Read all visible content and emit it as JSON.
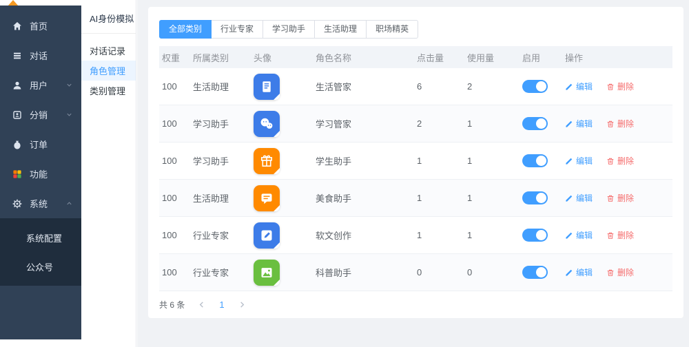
{
  "brand": {
    "arrow_color": "#f59a23"
  },
  "sidebar": {
    "bg": "#304156",
    "submenu_bg": "#1f2d3d",
    "items": [
      {
        "label": "首页",
        "icon": "home-icon"
      },
      {
        "label": "对话",
        "icon": "chat-list-icon"
      },
      {
        "label": "用户",
        "icon": "user-icon",
        "arrow": "down"
      },
      {
        "label": "分销",
        "icon": "distribution-icon",
        "arrow": "down"
      },
      {
        "label": "订单",
        "icon": "order-icon"
      },
      {
        "label": "功能",
        "icon": "features-grid-icon"
      },
      {
        "label": "系统",
        "icon": "gear-icon",
        "arrow": "up",
        "expanded": true
      }
    ],
    "system_submenu": [
      {
        "label": "系统配置"
      },
      {
        "label": "公众号"
      }
    ]
  },
  "panel": {
    "title": "AI身份模拟",
    "items": [
      {
        "label": "对话记录",
        "active": false
      },
      {
        "label": "角色管理",
        "active": true
      },
      {
        "label": "类别管理",
        "active": false
      }
    ],
    "active_color": "#409eff",
    "active_bg": "#ecf5ff"
  },
  "tabs": [
    {
      "label": "全部类别",
      "active": true
    },
    {
      "label": "行业专家",
      "active": false
    },
    {
      "label": "学习助手",
      "active": false
    },
    {
      "label": "生活助理",
      "active": false
    },
    {
      "label": "职场精英",
      "active": false
    }
  ],
  "table": {
    "columns": {
      "weight": "权重",
      "category": "所属类别",
      "avatar": "头像",
      "name": "角色名称",
      "clicks": "点击量",
      "usage": "使用量",
      "enabled": "启用",
      "actions": "操作"
    },
    "edit_label": "编辑",
    "delete_label": "删除",
    "rows": [
      {
        "weight": "100",
        "category": "生活助理",
        "avatar_icon": "document-icon",
        "avatar_style": "background:#3d7ce8;color:#3d7ce8",
        "name": "生活管家",
        "clicks": "6",
        "usage": "2",
        "enabled": true
      },
      {
        "weight": "100",
        "category": "学习助手",
        "avatar_icon": "wechat-icon",
        "avatar_style": "background:#3d7ce8;color:#3d7ce8",
        "name": "学习管家",
        "clicks": "2",
        "usage": "1",
        "enabled": true
      },
      {
        "weight": "100",
        "category": "学习助手",
        "avatar_icon": "gift-icon",
        "avatar_style": "background:#ff8a00;color:#ff8a00",
        "name": "学生助手",
        "clicks": "1",
        "usage": "1",
        "enabled": true
      },
      {
        "weight": "100",
        "category": "生活助理",
        "avatar_icon": "message-icon",
        "avatar_style": "background:#ff8a00;color:#ff8a00",
        "name": "美食助手",
        "clicks": "1",
        "usage": "1",
        "enabled": true
      },
      {
        "weight": "100",
        "category": "行业专家",
        "avatar_icon": "compose-icon",
        "avatar_style": "background:#3d7ce8;color:#3d7ce8",
        "name": "软文创作",
        "clicks": "1",
        "usage": "1",
        "enabled": true
      },
      {
        "weight": "100",
        "category": "行业专家",
        "avatar_icon": "image-icon",
        "avatar_style": "background:#6abf3f;color:#6abf3f",
        "name": "科普助手",
        "clicks": "0",
        "usage": "0",
        "enabled": true
      }
    ]
  },
  "pagination": {
    "total": "共 6 条",
    "page": "1"
  },
  "colors": {
    "primary": "#409eff",
    "danger": "#f56c6c",
    "toggle_on": "#409eff",
    "page_bg": "#f0f2f5"
  }
}
